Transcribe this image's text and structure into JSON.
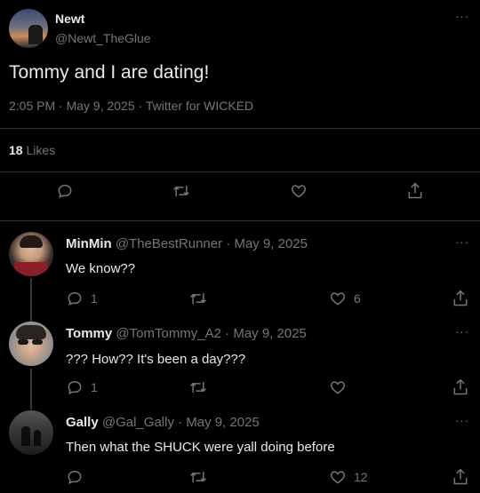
{
  "main_tweet": {
    "name": "Newt",
    "handle": "@Newt_TheGlue",
    "text": "Tommy and I are dating!",
    "meta": "2:05 PM · May 9, 2025 · Twitter for WICKED",
    "likes_count": "18",
    "likes_label": "Likes",
    "more": "···"
  },
  "replies": [
    {
      "name": "MinMin",
      "handle": "@TheBestRunner · May 9, 2025",
      "text": "We know??",
      "reply_count": "1",
      "like_count": "6",
      "more": "···"
    },
    {
      "name": "Tommy",
      "handle": "@TomTommy_A2 · May 9, 2025",
      "text": "??? How?? It's been a day???",
      "reply_count": "1",
      "like_count": "",
      "more": "···"
    },
    {
      "name": "Gally",
      "handle": "@Gal_Gally · May 9, 2025",
      "text": "Then what the SHUCK were yall doing before",
      "reply_count": "",
      "like_count": "12",
      "more": "···"
    }
  ],
  "colors": {
    "background": "#000000",
    "text": "#e7e9ea",
    "muted": "#71767b",
    "divider": "#2f3336"
  },
  "icons": [
    "reply-icon",
    "retweet-icon",
    "like-icon",
    "share-icon",
    "more-icon"
  ]
}
